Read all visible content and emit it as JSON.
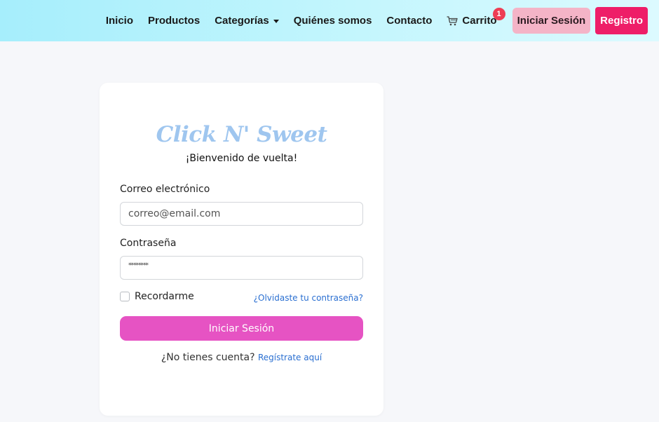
{
  "nav": {
    "links": [
      "Inicio",
      "Productos",
      "Categorías",
      "Quiénes somos",
      "Contacto"
    ],
    "cart_label": "Carrito",
    "cart_count": "1",
    "login_label": "Iniciar Sesión",
    "register_label": "Registro",
    "icons": {
      "dropdown": "caret-down-icon",
      "cart": "cart-icon"
    }
  },
  "login": {
    "brand": "Click N' Sweet",
    "welcome": "¡Bienvenido de vuelta!",
    "email_label": "Correo electrónico",
    "email_placeholder": "correo@email.com",
    "password_label": "Contraseña",
    "password_value": "********",
    "remember_label": "Recordarme",
    "forgot_label": "¿Olvidaste tu contraseña?",
    "submit_label": "Iniciar Sesión",
    "signup_prompt": "¿No tienes cuenta?",
    "signup_link": "Regístrate aquí"
  },
  "colors": {
    "navbar_gradient": [
      "#a6eefc",
      "#dcfaff"
    ],
    "brand": "#9fc6ef",
    "submit": "#e653c3",
    "register": "#ee1e68",
    "login_nav": "#f4b4c7",
    "badge": "#ee3d54",
    "link": "#2a6fd1"
  }
}
